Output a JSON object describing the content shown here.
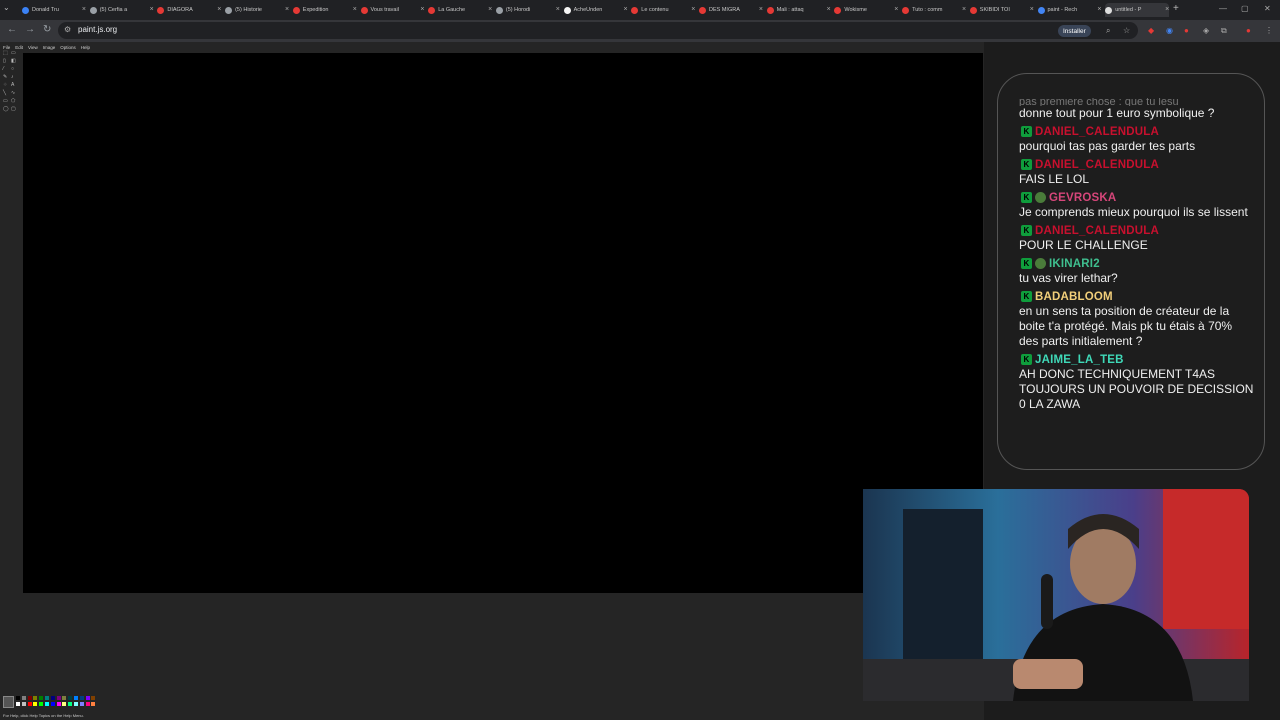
{
  "browser": {
    "tabs": [
      {
        "label": "Donald Tru",
        "color": "#3b82f6"
      },
      {
        "label": "(5) Cerfia a",
        "color": "#9aa0a6"
      },
      {
        "label": "DIAGORA",
        "color": "#e53935"
      },
      {
        "label": "(5) Historie",
        "color": "#9aa0a6"
      },
      {
        "label": "Expedition",
        "color": "#e53935"
      },
      {
        "label": "Vous travail",
        "color": "#e53935"
      },
      {
        "label": "La Gauche",
        "color": "#e53935"
      },
      {
        "label": "(5) Horodi",
        "color": "#9aa0a6"
      },
      {
        "label": "AcheUnden",
        "color": "#f5f5f5"
      },
      {
        "label": "Le contenu",
        "color": "#e53935"
      },
      {
        "label": "DES MIGRA",
        "color": "#e53935"
      },
      {
        "label": "Mali : attaq",
        "color": "#e53935"
      },
      {
        "label": "Wokisme",
        "color": "#e53935"
      },
      {
        "label": "Tuto : comm",
        "color": "#e53935"
      },
      {
        "label": "SKIBIDI TOI",
        "color": "#e53935"
      },
      {
        "label": "paint - Rech",
        "color": "#4285f4"
      },
      {
        "label": "untitled - P",
        "color": "#dddddd"
      }
    ],
    "url": "paint.js.org",
    "install_label": "Installer"
  },
  "paint": {
    "menu": [
      "File",
      "Edit",
      "View",
      "Image",
      "Options",
      "Help"
    ],
    "status": "For Help, click Help Topics on the Help Menu."
  },
  "chat": {
    "cutoff_text": "pas premiere chose : que tu lesu",
    "messages": [
      {
        "user": "",
        "text": "donne tout pour 1 euro symbolique ?",
        "color": "#ffffff",
        "extra_badge": false
      },
      {
        "user": "DANIEL_CALENDULA",
        "text": "pourquoi tas pas garder tes parts",
        "color": "#c8102e",
        "extra_badge": false
      },
      {
        "user": "DANIEL_CALENDULA",
        "text": "FAIS LE LOL",
        "color": "#c8102e",
        "extra_badge": false
      },
      {
        "user": "GEVROSKA",
        "text": "Je comprends mieux pourquoi ils se lissent",
        "color": "#d6467a",
        "extra_badge": true
      },
      {
        "user": "DANIEL_CALENDULA",
        "text": "POUR LE CHALLENGE",
        "color": "#c8102e",
        "extra_badge": false
      },
      {
        "user": "IKINARI2",
        "text": "tu vas virer lethar?",
        "color": "#3fbf8f",
        "extra_badge": true
      },
      {
        "user": "BADABLOOM",
        "text": "en un sens ta position de créateur de la boite t'a protégé. Mais pk tu étais à 70% des parts initialement ?",
        "color": "#f2cf7a",
        "extra_badge": false
      },
      {
        "user": "JAIME_LA_TEB",
        "text": "AH DONC TECHNIQUEMENT T4AS TOUJOURS UN POUVOIR DE DECISSION 0 LA ZAWA",
        "color": "#3fd9b8",
        "extra_badge": false
      }
    ]
  }
}
